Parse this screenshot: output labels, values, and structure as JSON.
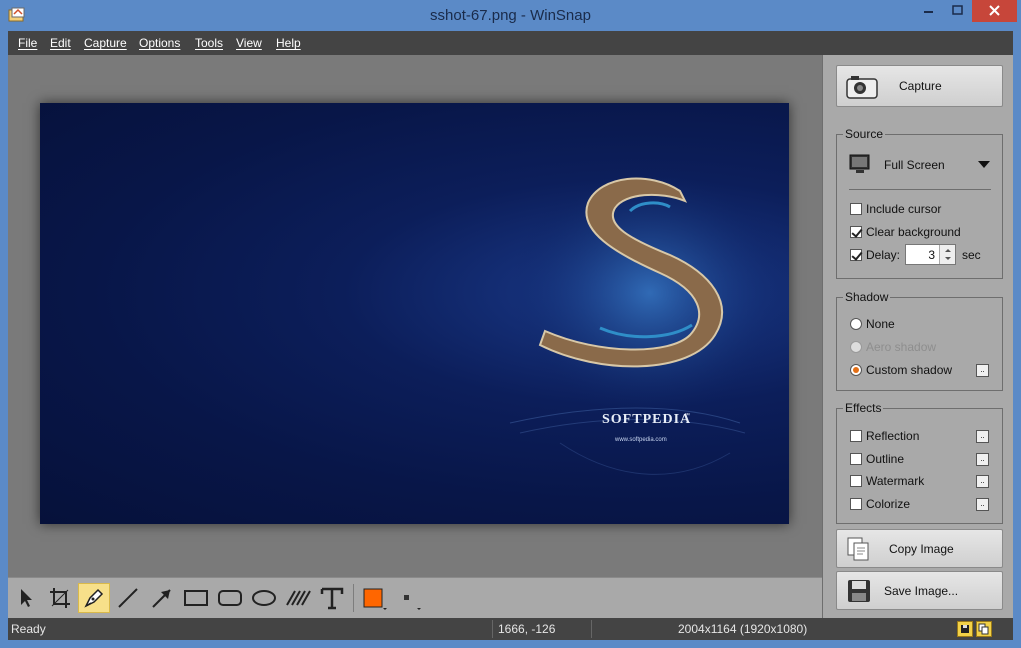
{
  "window": {
    "title": "sshot-67.png - WinSnap",
    "icon": "winsnap-app-icon",
    "controls": [
      "minimize-icon",
      "maximize-icon",
      "close-icon"
    ]
  },
  "menu": [
    "File",
    "Edit",
    "Capture",
    "Options",
    "Tools",
    "View",
    "Help"
  ],
  "canvas": {
    "image": {
      "brand": "SOFTPEDIA",
      "tm": "™",
      "url": "www.softpedia.com"
    }
  },
  "toolbar": {
    "tools": [
      "pointer-icon",
      "crop-icon",
      "pen-icon",
      "line-icon",
      "arrow-icon",
      "rectangle-icon",
      "rounded-rectangle-icon",
      "ellipse-icon",
      "hatch-icon",
      "text-icon"
    ],
    "active_tool": "pen-icon",
    "color": "#ff6600"
  },
  "panel": {
    "capture_label": "Capture",
    "source": {
      "title": "Source",
      "mode": "Full Screen",
      "include_cursor": "Include cursor",
      "clear_background": "Clear background",
      "delay_label": "Delay:",
      "delay_value": "3",
      "delay_unit": "sec"
    },
    "shadow": {
      "title": "Shadow",
      "none": "None",
      "aero": "Aero shadow",
      "custom": "Custom shadow"
    },
    "effects": {
      "title": "Effects",
      "reflection": "Reflection",
      "outline": "Outline",
      "watermark": "Watermark",
      "colorize": "Colorize"
    },
    "copy_label": "Copy Image",
    "save_label": "Save Image..."
  },
  "status": {
    "state": "Ready",
    "coords": "1666, -126",
    "size": "2004x1164 (1920x1080)"
  }
}
